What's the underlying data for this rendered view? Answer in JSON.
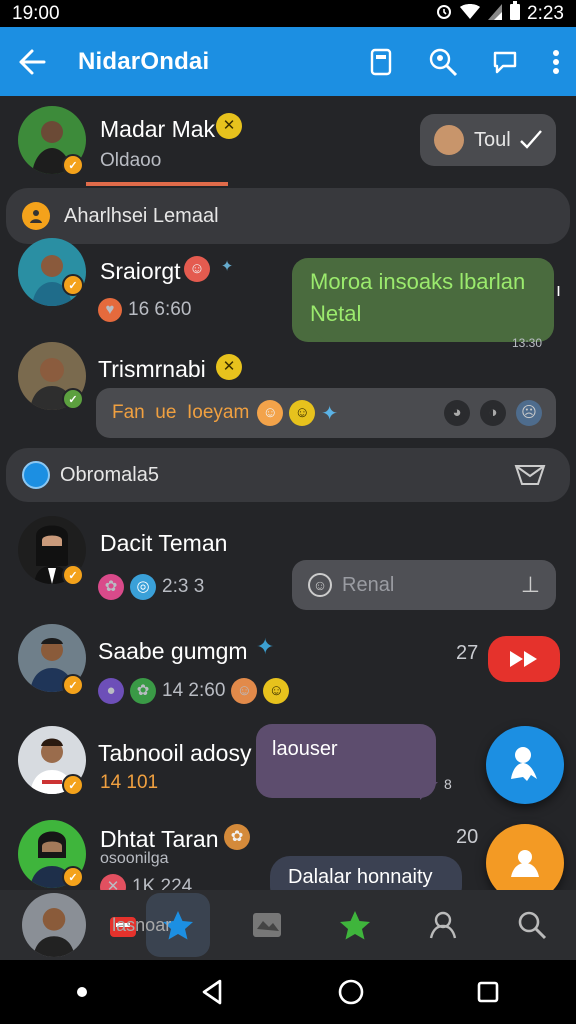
{
  "status": {
    "time": "19:00",
    "time_right": "2:23"
  },
  "appbar": {
    "title": "NidarOndai"
  },
  "header_chip": {
    "label": "Toul"
  },
  "contacts": [
    {
      "name": "Madar Mak",
      "sub": "Oldaoo"
    },
    {
      "name": "Sraiorgt",
      "sub": "16 6:60",
      "message": "Moroa insoaks lbarlan Netal",
      "time": "13:30"
    },
    {
      "name": "Trismrnabi",
      "input_text": "Fan  ue  Ioeyam"
    },
    {
      "name": "Dacit Teman",
      "sub": "2:3 3",
      "input_placeholder": "Renal"
    },
    {
      "name": "Saabe gumgm",
      "sub": "14 2:60",
      "count": "27"
    },
    {
      "name": "Tabnooil adosy",
      "sub": "14 101",
      "message": "laouser",
      "time": "8"
    },
    {
      "name": "Dhtat Taran",
      "sub": "osoonilga",
      "sub2": "1K 224",
      "message": "Dalalar honnaity",
      "count": "20"
    }
  ],
  "sections": {
    "first": "Aharlhsei Lemaal",
    "second": "Obromala5"
  },
  "bottomnav": {
    "partial_label": "lasnoar"
  },
  "colors": {
    "appbar": "#1c8fe2",
    "background": "#242528",
    "fab_blue": "#1c8fe2",
    "fab_orange": "#f39a24",
    "youtube_red": "#e5322c"
  }
}
